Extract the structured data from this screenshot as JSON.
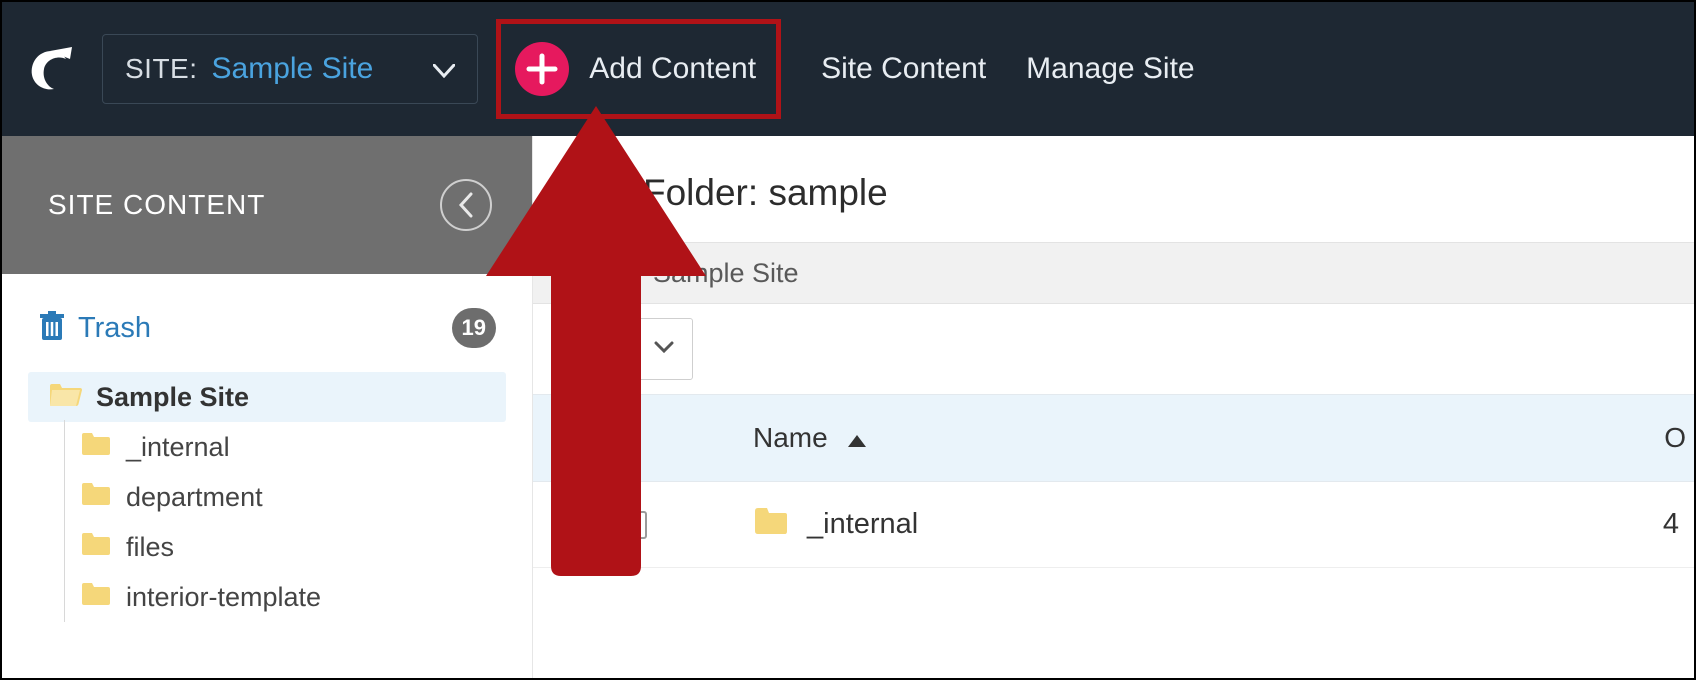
{
  "topnav": {
    "site_label": "SITE:",
    "site_name": "Sample Site",
    "add_content_label": "Add Content",
    "menu_site_content": "Site Content",
    "menu_manage_site": "Manage Site"
  },
  "sidebar": {
    "title": "SITE CONTENT",
    "trash_label": "Trash",
    "trash_count": "19",
    "tree": {
      "root": "Sample Site",
      "children": [
        "_internal",
        "department",
        "files",
        "interior-template"
      ]
    }
  },
  "main": {
    "page_title_prefix": "Folder: ",
    "page_title_value": "sample",
    "toolbar_site": "Sample Site",
    "columns": {
      "name": "Name",
      "right": "O"
    },
    "rows": [
      {
        "name": "_internal",
        "right": "4"
      }
    ]
  }
}
